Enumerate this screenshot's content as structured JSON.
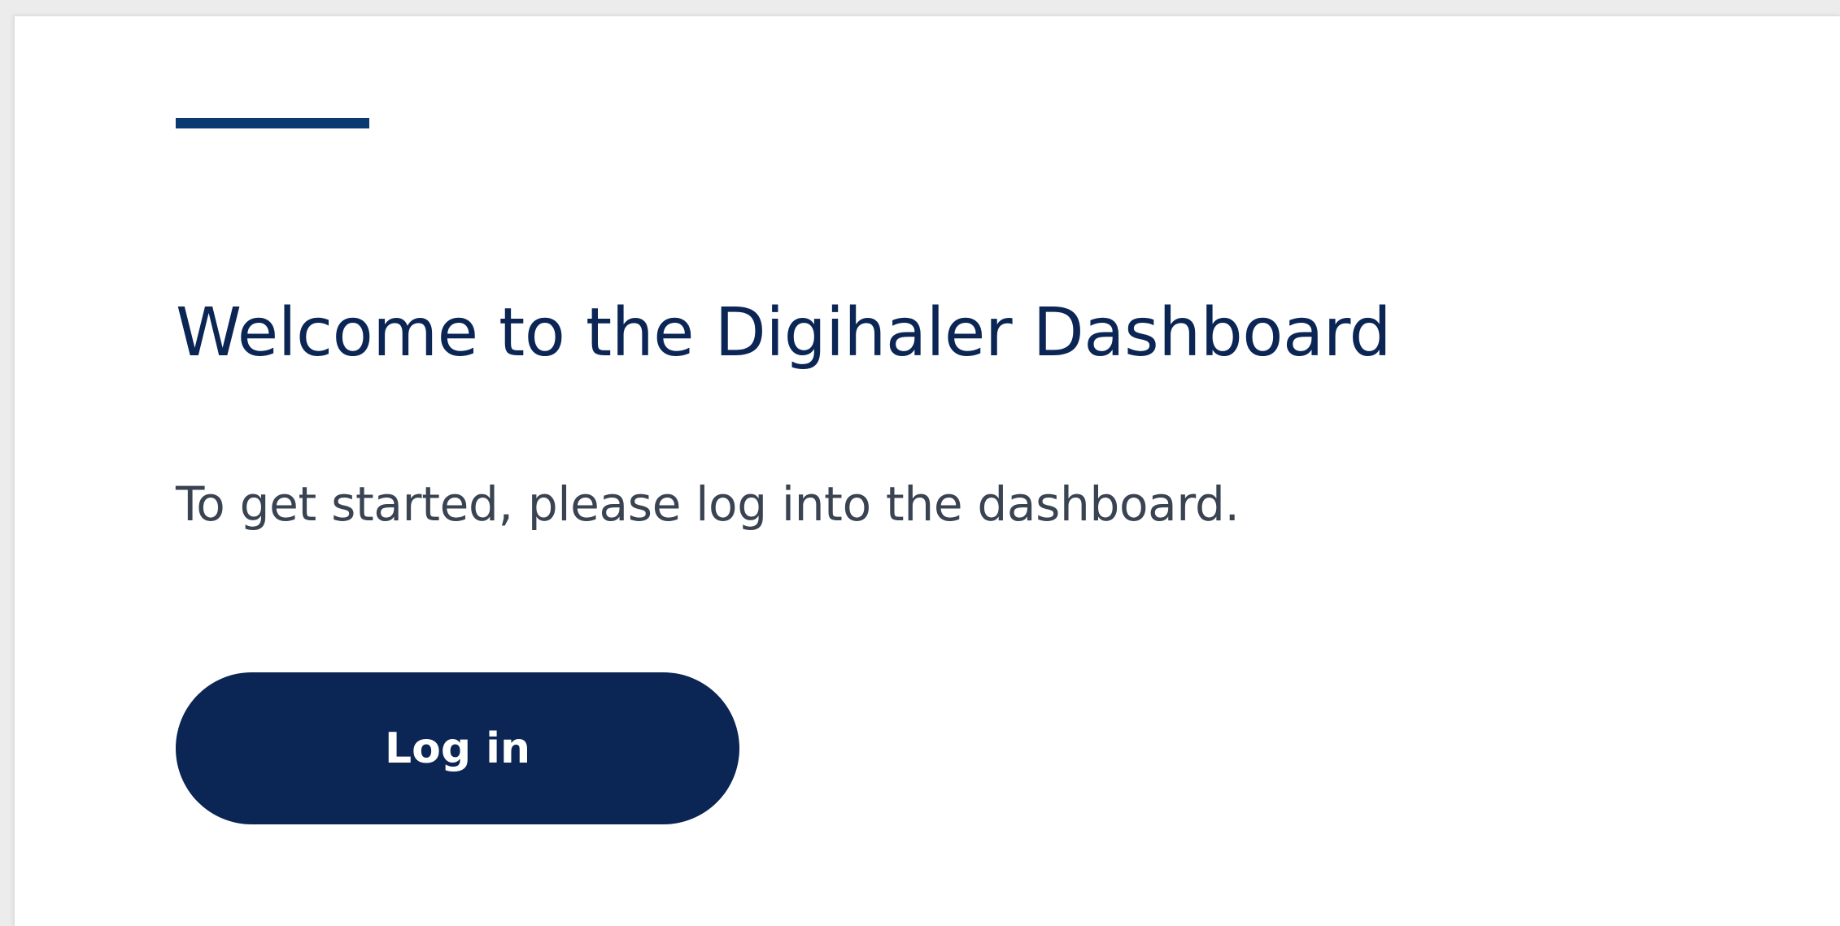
{
  "main": {
    "title": "Welcome to the Digihaler Dashboard",
    "subtitle": "To get started, please log into the dashboard.",
    "login_label": "Log in"
  },
  "colors": {
    "accent": "#0a3a72",
    "primary": "#0b2554",
    "text_secondary": "#3a4352",
    "background": "#ffffff"
  }
}
